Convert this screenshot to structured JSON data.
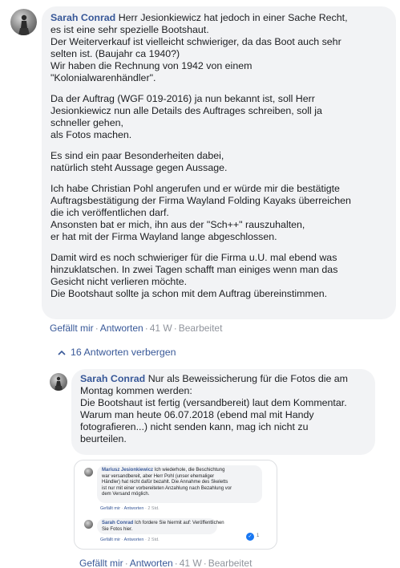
{
  "comment": {
    "author": "Sarah Conrad",
    "paragraphs": [
      [
        "Herr Jesionkiewicz hat jedoch in einer Sache Recht,",
        "es ist eine sehr spezielle Bootshaut.",
        "Der Weiterverkauf ist vielleicht schwieriger, da das Boot auch sehr",
        "selten ist. (Baujahr ca 1940?)",
        "Wir haben die Rechnung von 1942 von einem",
        "\"Kolonialwarenhändler\"."
      ],
      [
        "Da der Auftrag (WGF 019-2016) ja nun bekannt ist, soll Herr",
        "Jesionkiewicz nun alle Details des Auftrages schreiben, soll ja",
        "schneller gehen,",
        "als Fotos machen."
      ],
      [
        "Es sind ein paar Besonderheiten dabei,",
        "natürlich steht Aussage gegen Aussage."
      ],
      [
        "Ich habe Christian Pohl angerufen und er würde mir die bestätigte",
        "Auftragsbestätigung der Firma Wayland Folding Kayaks überreichen",
        "die ich veröffentlichen darf.",
        "Ansonsten bat er mich, ihn aus der \"Sch++\" rauszuhalten,",
        "er hat mit der Firma Wayland lange abgeschlossen."
      ],
      [
        "Damit wird es noch schwieriger für die Firma u.U. mal ebend was",
        "hinzuklatschen. In zwei Tagen schafft man einiges wenn man das",
        "Gesicht nicht verlieren möchte.",
        "Die Bootshaut sollte ja schon mit dem Auftrag übereinstimmen."
      ]
    ],
    "actions": {
      "like": "Gefällt mir",
      "reply": "Antworten",
      "time": "41 W",
      "edit": "Bearbeitet"
    }
  },
  "replies_toggle": "16 Antworten verbergen",
  "reply": {
    "author": "Sarah Conrad",
    "lines": [
      "Nur als Beweissicherung für die Fotos die am",
      "Montag kommen werden:",
      "Die Bootshaut ist fertig (versandbereit) laut dem Kommentar.",
      "Warum man heute 06.07.2018 (ebend mal mit Handy",
      "fotografieren...) nicht senden kann, mag ich nicht zu",
      "beurteilen."
    ],
    "attachment": {
      "comment1": {
        "author": "Mariusz Jesionkiewicz",
        "lines": [
          "Ich wiederhole, die Beschichtung",
          "war versandbereit, aber Herr Pohl (unser ehemaliger",
          "Händler) hat nicht dafür bezahlt. Die Annahme des Skeletts",
          "ist nur mit einer vorbereiteten Anzahlung nach Bezahlung vor",
          "dem Versand möglich."
        ],
        "actions": {
          "like": "Gefällt mir",
          "reply": "Antworten",
          "time": "2 Std."
        }
      },
      "comment2": {
        "author": "Sarah Conrad",
        "lines": [
          "Ich fordere Sie hiermit auf: Veröffentlichen",
          "Sie Fotos hier."
        ],
        "actions": {
          "like": "Gefällt mir",
          "reply": "Antworten",
          "time": "2 Std."
        },
        "like_count": "1"
      }
    },
    "actions": {
      "like": "Gefällt mir",
      "reply": "Antworten",
      "time": "41 W",
      "edit": "Bearbeitet"
    }
  },
  "colors": {
    "bubble": "#f2f3f5",
    "author": "#385898",
    "meta": "#90949c",
    "text": "#1c1e21"
  }
}
